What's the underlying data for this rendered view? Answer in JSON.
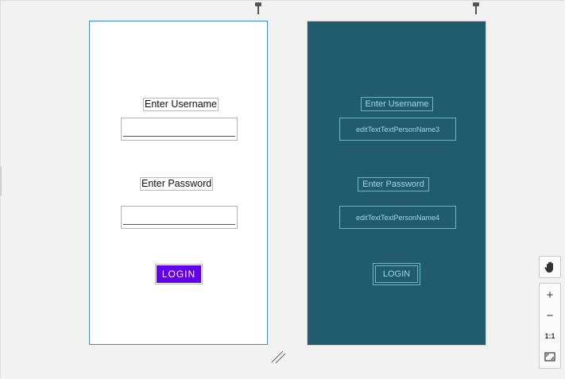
{
  "design": {
    "username_label": "Enter Username",
    "password_label": "Enter Password",
    "login_label": "LOGIN"
  },
  "blueprint": {
    "username_label": "Enter Username",
    "username_input_id": "editTextTextPersonName3",
    "password_label": "Enter Password",
    "password_input_id": "editTextTextPersonName4",
    "login_label": "LOGIN"
  },
  "toolbar": {
    "pan_icon": "hand-icon",
    "zoom_in_label": "+",
    "zoom_out_label": "−",
    "actual_size_label": "1:1",
    "fit_icon": "fit-screen-icon"
  },
  "colors": {
    "accent": "#6200ee",
    "blueprint_bg": "#215c6e",
    "blueprint_line": "#6fb6c6",
    "selection": "#3d8ad8"
  }
}
